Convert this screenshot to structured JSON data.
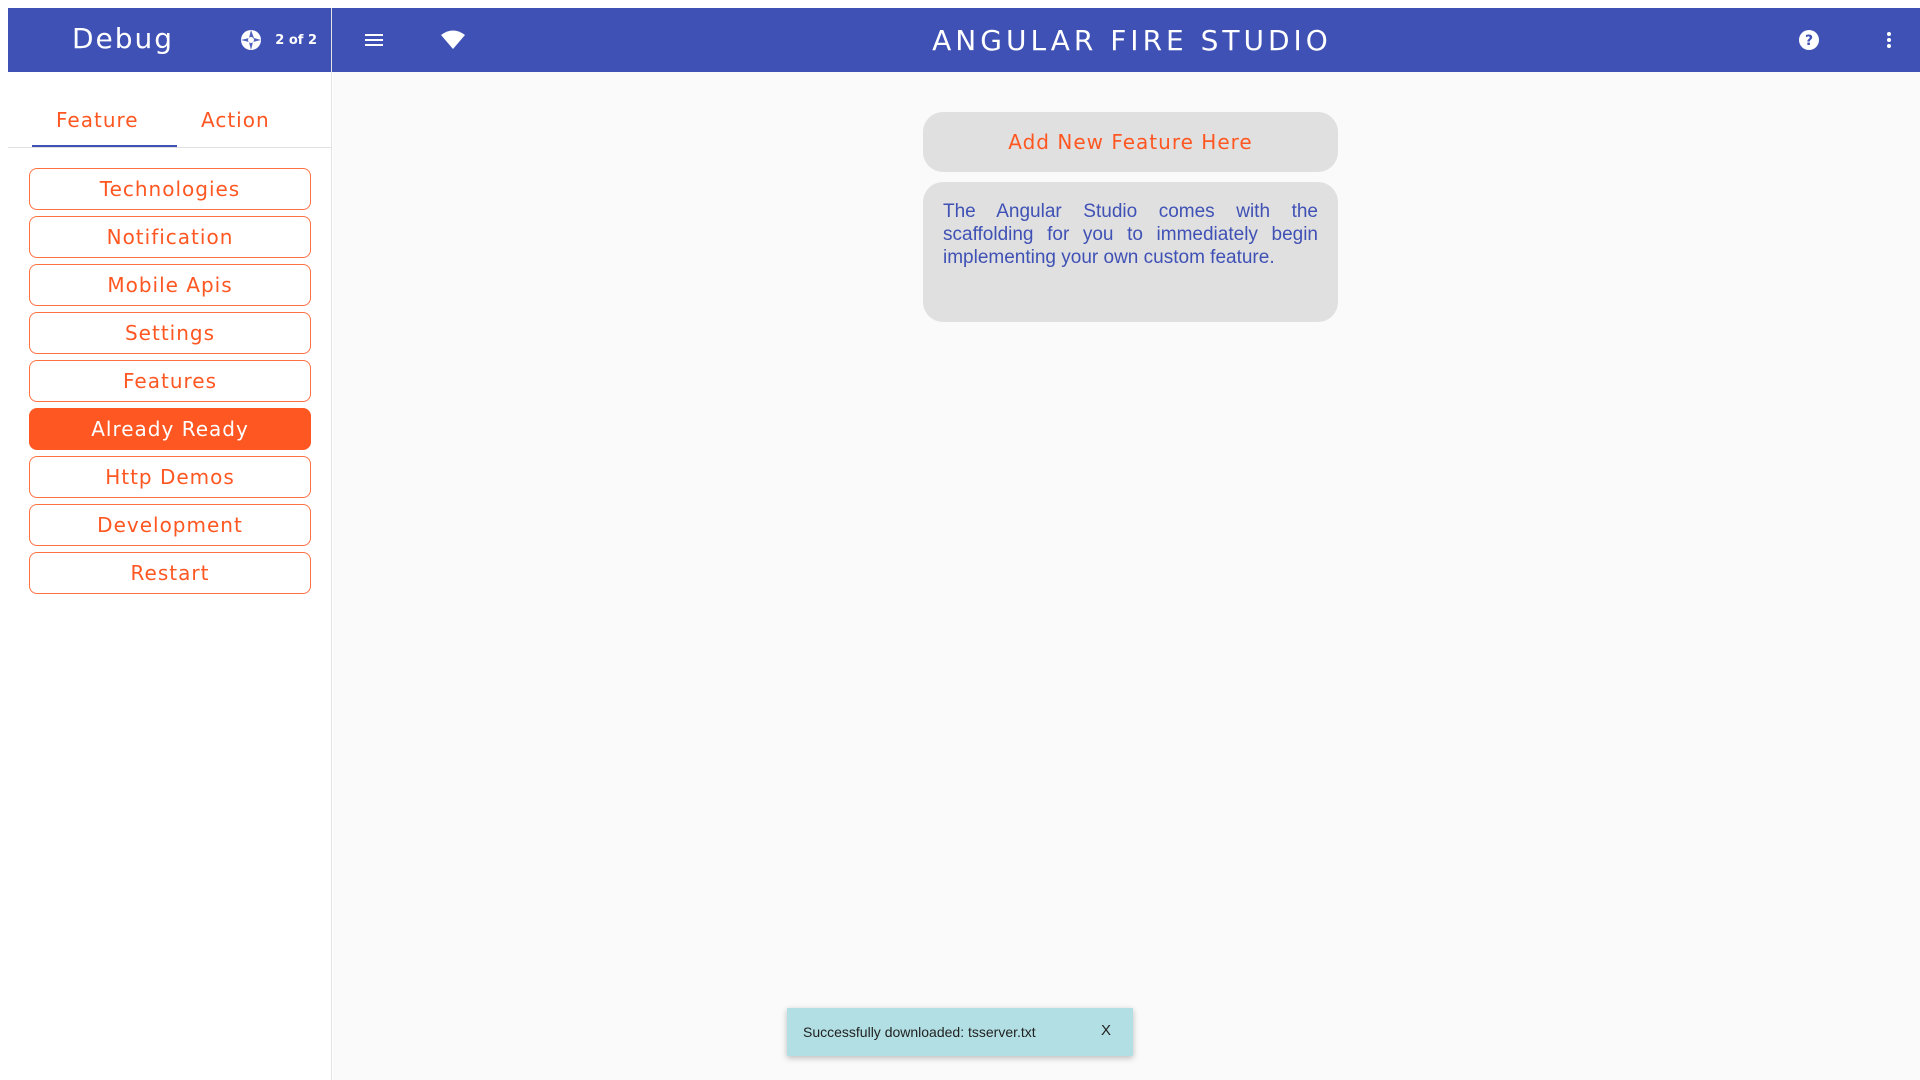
{
  "sidebar": {
    "title": "Debug",
    "pager": {
      "icon": "aperture-icon",
      "text": "2 of 2"
    },
    "tabs": [
      {
        "label": "Feature",
        "active": true
      },
      {
        "label": "Action",
        "active": false
      }
    ],
    "items": [
      {
        "label": "Technologies",
        "active": false
      },
      {
        "label": "Notification",
        "active": false
      },
      {
        "label": "Mobile Apis",
        "active": false
      },
      {
        "label": "Settings",
        "active": false
      },
      {
        "label": "Features",
        "active": false
      },
      {
        "label": "Already Ready",
        "active": true
      },
      {
        "label": "Http Demos",
        "active": false
      },
      {
        "label": "Development",
        "active": false
      },
      {
        "label": "Restart",
        "active": false
      }
    ]
  },
  "toolbar": {
    "title": "ANGULAR FIRE STUDIO",
    "icons": [
      "menu-icon",
      "wifi-icon",
      "help-icon",
      "more-vert-icon"
    ]
  },
  "main": {
    "add_feature_label": "Add New Feature Here",
    "info_text": "The Angular Studio comes with the scaffolding for you to immediately begin implementing your own custom feature."
  },
  "snackbar": {
    "message": "Successfully downloaded: tsserver.txt",
    "close_label": "X"
  },
  "colors": {
    "primary": "#3f51b5",
    "accent": "#ff5722",
    "card_bg": "#e0e0e0",
    "snackbar_bg": "#b2dfe3"
  }
}
